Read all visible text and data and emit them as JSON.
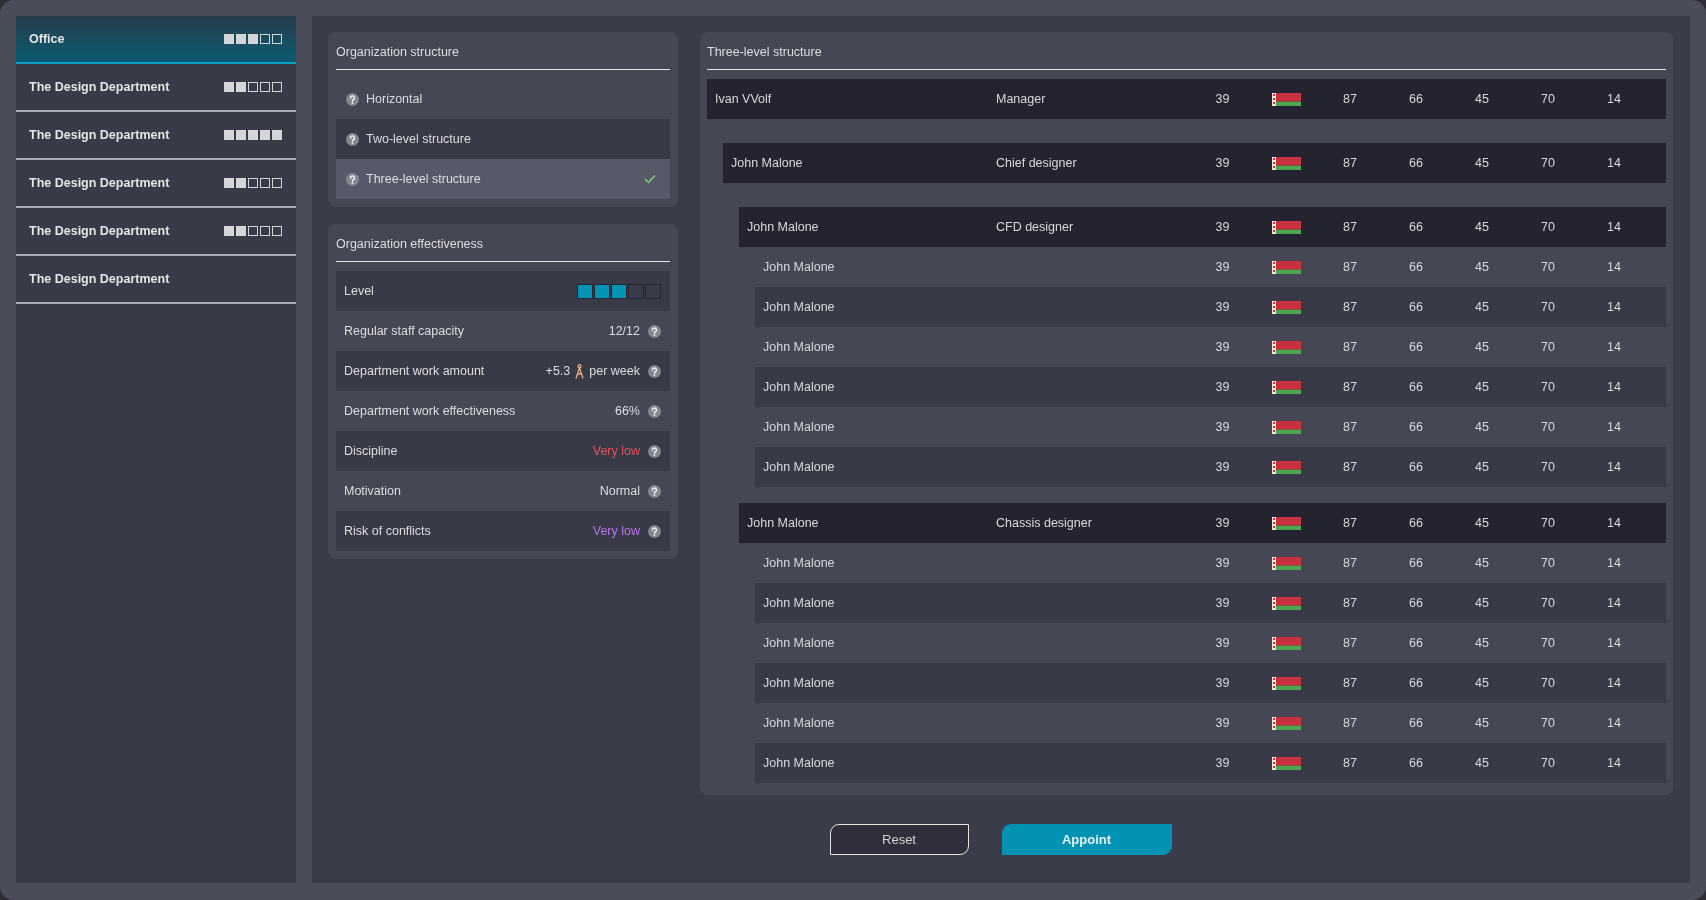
{
  "sidebar": {
    "items": [
      {
        "label": "Office",
        "stars": 3,
        "selected": true
      },
      {
        "label": "The Design Department",
        "stars": 2,
        "selected": false
      },
      {
        "label": "The Design Department",
        "stars": 5,
        "selected": false
      },
      {
        "label": "The Design Department",
        "stars": 2,
        "selected": false
      },
      {
        "label": "The Design Department",
        "stars": 2,
        "selected": false
      },
      {
        "label": "The Design Department",
        "selected": false
      }
    ]
  },
  "structure": {
    "title": "Organization structure",
    "options": [
      {
        "label": "Horizontal",
        "selected": false
      },
      {
        "label": "Two-level structure",
        "selected": false
      },
      {
        "label": "Three-level structure",
        "selected": true
      }
    ]
  },
  "effectiveness": {
    "title": "Organization effectiveness",
    "rows": [
      {
        "kind": "meter",
        "label": "Level",
        "stars": 3
      },
      {
        "kind": "value",
        "label": "Regular staff capacity",
        "value": "12/12"
      },
      {
        "kind": "amount",
        "label": "Department work amount",
        "value": "+5.3",
        "suffix": "per week"
      },
      {
        "kind": "value",
        "label": "Department work effectiveness",
        "value": "66%"
      },
      {
        "kind": "value",
        "label": "Discipline",
        "value": "Very low",
        "color": "#e3525c"
      },
      {
        "kind": "value",
        "label": "Motivation",
        "value": "Normal"
      },
      {
        "kind": "value",
        "label": "Risk of conflicts",
        "value": "Very low",
        "color": "#b874e6"
      }
    ]
  },
  "hierarchy": {
    "title": "Three-level structure",
    "rows": [
      {
        "name": "Ivan VVolf",
        "role": "Manager",
        "cells": [
          "39",
          "87",
          "66",
          "45",
          "70",
          "14"
        ],
        "children": [
          {
            "name": "John Malone",
            "role": "Chief designer",
            "cells": [
              "39",
              "87",
              "66",
              "45",
              "70",
              "14"
            ],
            "children": [
              {
                "name": "John Malone",
                "role": "CFD designer",
                "cells": [
                  "39",
                  "87",
                  "66",
                  "45",
                  "70",
                  "14"
                ],
                "children": [
                  {
                    "name": "John Malone",
                    "cells": [
                      "39",
                      "87",
                      "66",
                      "45",
                      "70",
                      "14"
                    ]
                  },
                  {
                    "name": "John Malone",
                    "cells": [
                      "39",
                      "87",
                      "66",
                      "45",
                      "70",
                      "14"
                    ]
                  },
                  {
                    "name": "John Malone",
                    "cells": [
                      "39",
                      "87",
                      "66",
                      "45",
                      "70",
                      "14"
                    ]
                  },
                  {
                    "name": "John Malone",
                    "cells": [
                      "39",
                      "87",
                      "66",
                      "45",
                      "70",
                      "14"
                    ]
                  },
                  {
                    "name": "John Malone",
                    "cells": [
                      "39",
                      "87",
                      "66",
                      "45",
                      "70",
                      "14"
                    ]
                  },
                  {
                    "name": "John Malone",
                    "cells": [
                      "39",
                      "87",
                      "66",
                      "45",
                      "70",
                      "14"
                    ]
                  }
                ]
              },
              {
                "name": "John Malone",
                "role": "Chassis designer",
                "cells": [
                  "39",
                  "87",
                  "66",
                  "45",
                  "70",
                  "14"
                ],
                "children": [
                  {
                    "name": "John Malone",
                    "cells": [
                      "39",
                      "87",
                      "66",
                      "45",
                      "70",
                      "14"
                    ]
                  },
                  {
                    "name": "John Malone",
                    "cells": [
                      "39",
                      "87",
                      "66",
                      "45",
                      "70",
                      "14"
                    ]
                  },
                  {
                    "name": "John Malone",
                    "cells": [
                      "39",
                      "87",
                      "66",
                      "45",
                      "70",
                      "14"
                    ]
                  },
                  {
                    "name": "John Malone",
                    "cells": [
                      "39",
                      "87",
                      "66",
                      "45",
                      "70",
                      "14"
                    ]
                  },
                  {
                    "name": "John Malone",
                    "cells": [
                      "39",
                      "87",
                      "66",
                      "45",
                      "70",
                      "14"
                    ]
                  },
                  {
                    "name": "John Malone",
                    "cells": [
                      "39",
                      "87",
                      "66",
                      "45",
                      "70",
                      "14"
                    ]
                  }
                ]
              }
            ]
          }
        ]
      }
    ]
  },
  "buttons": [
    {
      "label": "Reset",
      "kind": "secondary"
    },
    {
      "label": "Appoint",
      "kind": "primary"
    }
  ]
}
